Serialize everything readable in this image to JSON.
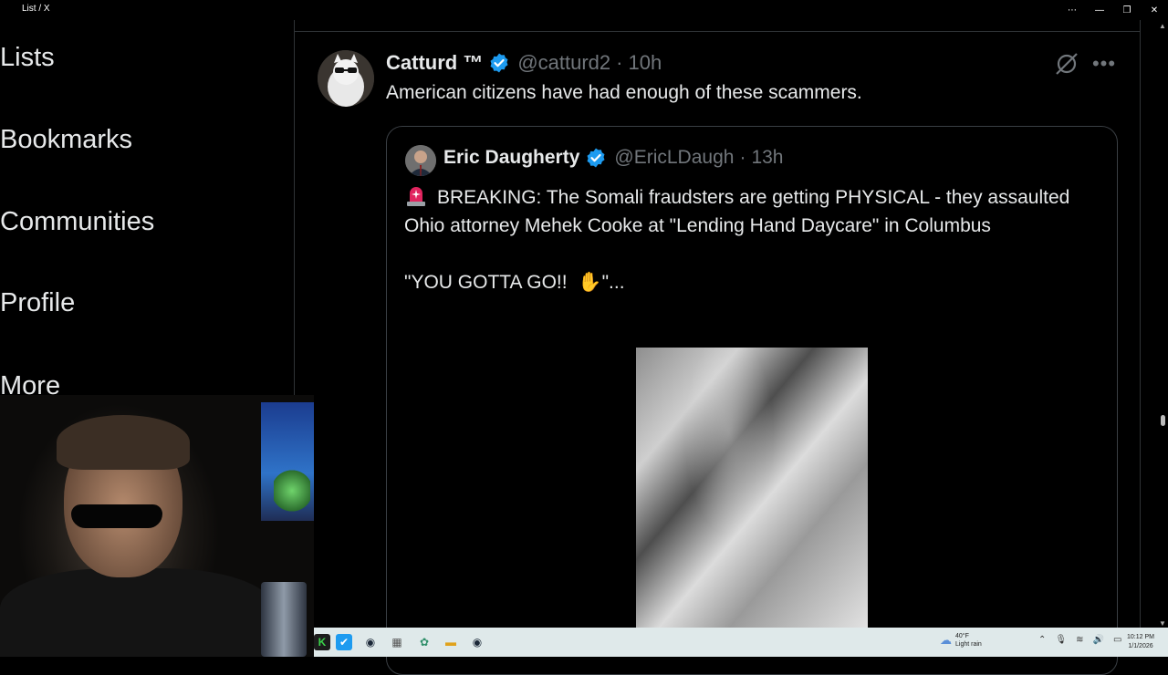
{
  "window": {
    "title": "List / X"
  },
  "nav": {
    "items": [
      {
        "label": "Lists"
      },
      {
        "label": "Bookmarks"
      },
      {
        "label": "Communities"
      },
      {
        "label": "Profile"
      },
      {
        "label": "More"
      }
    ]
  },
  "tweet": {
    "name": "Catturd ™",
    "handle": "@catturd2",
    "sep": "·",
    "time": "10h",
    "text": "American citizens have had enough of these scammers."
  },
  "quote": {
    "name": "Eric Daugherty",
    "handle": "@EricLDaugh",
    "sep": "·",
    "time": "13h",
    "text1": "BREAKING: The Somali fraudsters are getting PHYSICAL - they assaulted Ohio attorney Mehek Cooke at \"Lending Hand Daycare\" in Columbus",
    "text2_prefix": "\"YOU GOTTA GO!! ",
    "hand": "✋",
    "text2_suffix": "\"..."
  },
  "icons": {
    "verified": "verified-badge-icon",
    "grok": "grok-icon",
    "more": "more-icon",
    "alarm": "rotating-light-icon"
  },
  "colors": {
    "background": "#000000",
    "text": "#e7e9ea",
    "muted": "#71767b",
    "verified": "#1d9bf0",
    "border": "#2f3336",
    "taskbar": "#dfe9ea"
  },
  "taskbar": {
    "weather_temp": "40°F",
    "weather_desc": "Light rain",
    "time": "10:12 PM",
    "date": "1/1/2026"
  }
}
